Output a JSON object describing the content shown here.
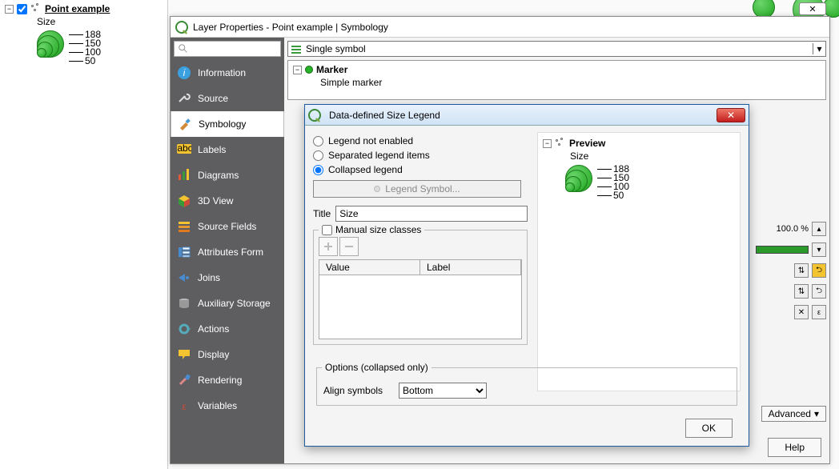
{
  "layers": {
    "name": "Point example",
    "attr": "Size",
    "classes": [
      "188",
      "150",
      "100",
      "50"
    ]
  },
  "propsWindow": {
    "title": "Layer Properties - Point example | Symbology",
    "symbolMode": "Single symbol",
    "markerTree": {
      "root": "Marker",
      "child": "Simple marker"
    },
    "opacity": "100.0 %",
    "advanced": "Advanced",
    "helpBtn": "Help"
  },
  "menu": {
    "items": [
      "Information",
      "Source",
      "Symbology",
      "Labels",
      "Diagrams",
      "3D View",
      "Source Fields",
      "Attributes Form",
      "Joins",
      "Auxiliary Storage",
      "Actions",
      "Display",
      "Rendering",
      "Variables"
    ],
    "active": 2
  },
  "dialog": {
    "title": "Data-defined Size Legend",
    "radios": {
      "notEnabled": "Legend not enabled",
      "separated": "Separated legend items",
      "collapsed": "Collapsed legend"
    },
    "legendSymbolBtn": "Legend Symbol...",
    "titleLabel": "Title",
    "titleValue": "Size",
    "manualGroup": "Manual size classes",
    "tableHeaders": {
      "value": "Value",
      "label": "Label"
    },
    "optionsGroup": "Options (collapsed only)",
    "alignLabel": "Align symbols",
    "alignValue": "Bottom",
    "ok": "OK",
    "preview": {
      "heading": "Preview",
      "attr": "Size",
      "classes": [
        "188",
        "150",
        "100",
        "50"
      ]
    }
  }
}
